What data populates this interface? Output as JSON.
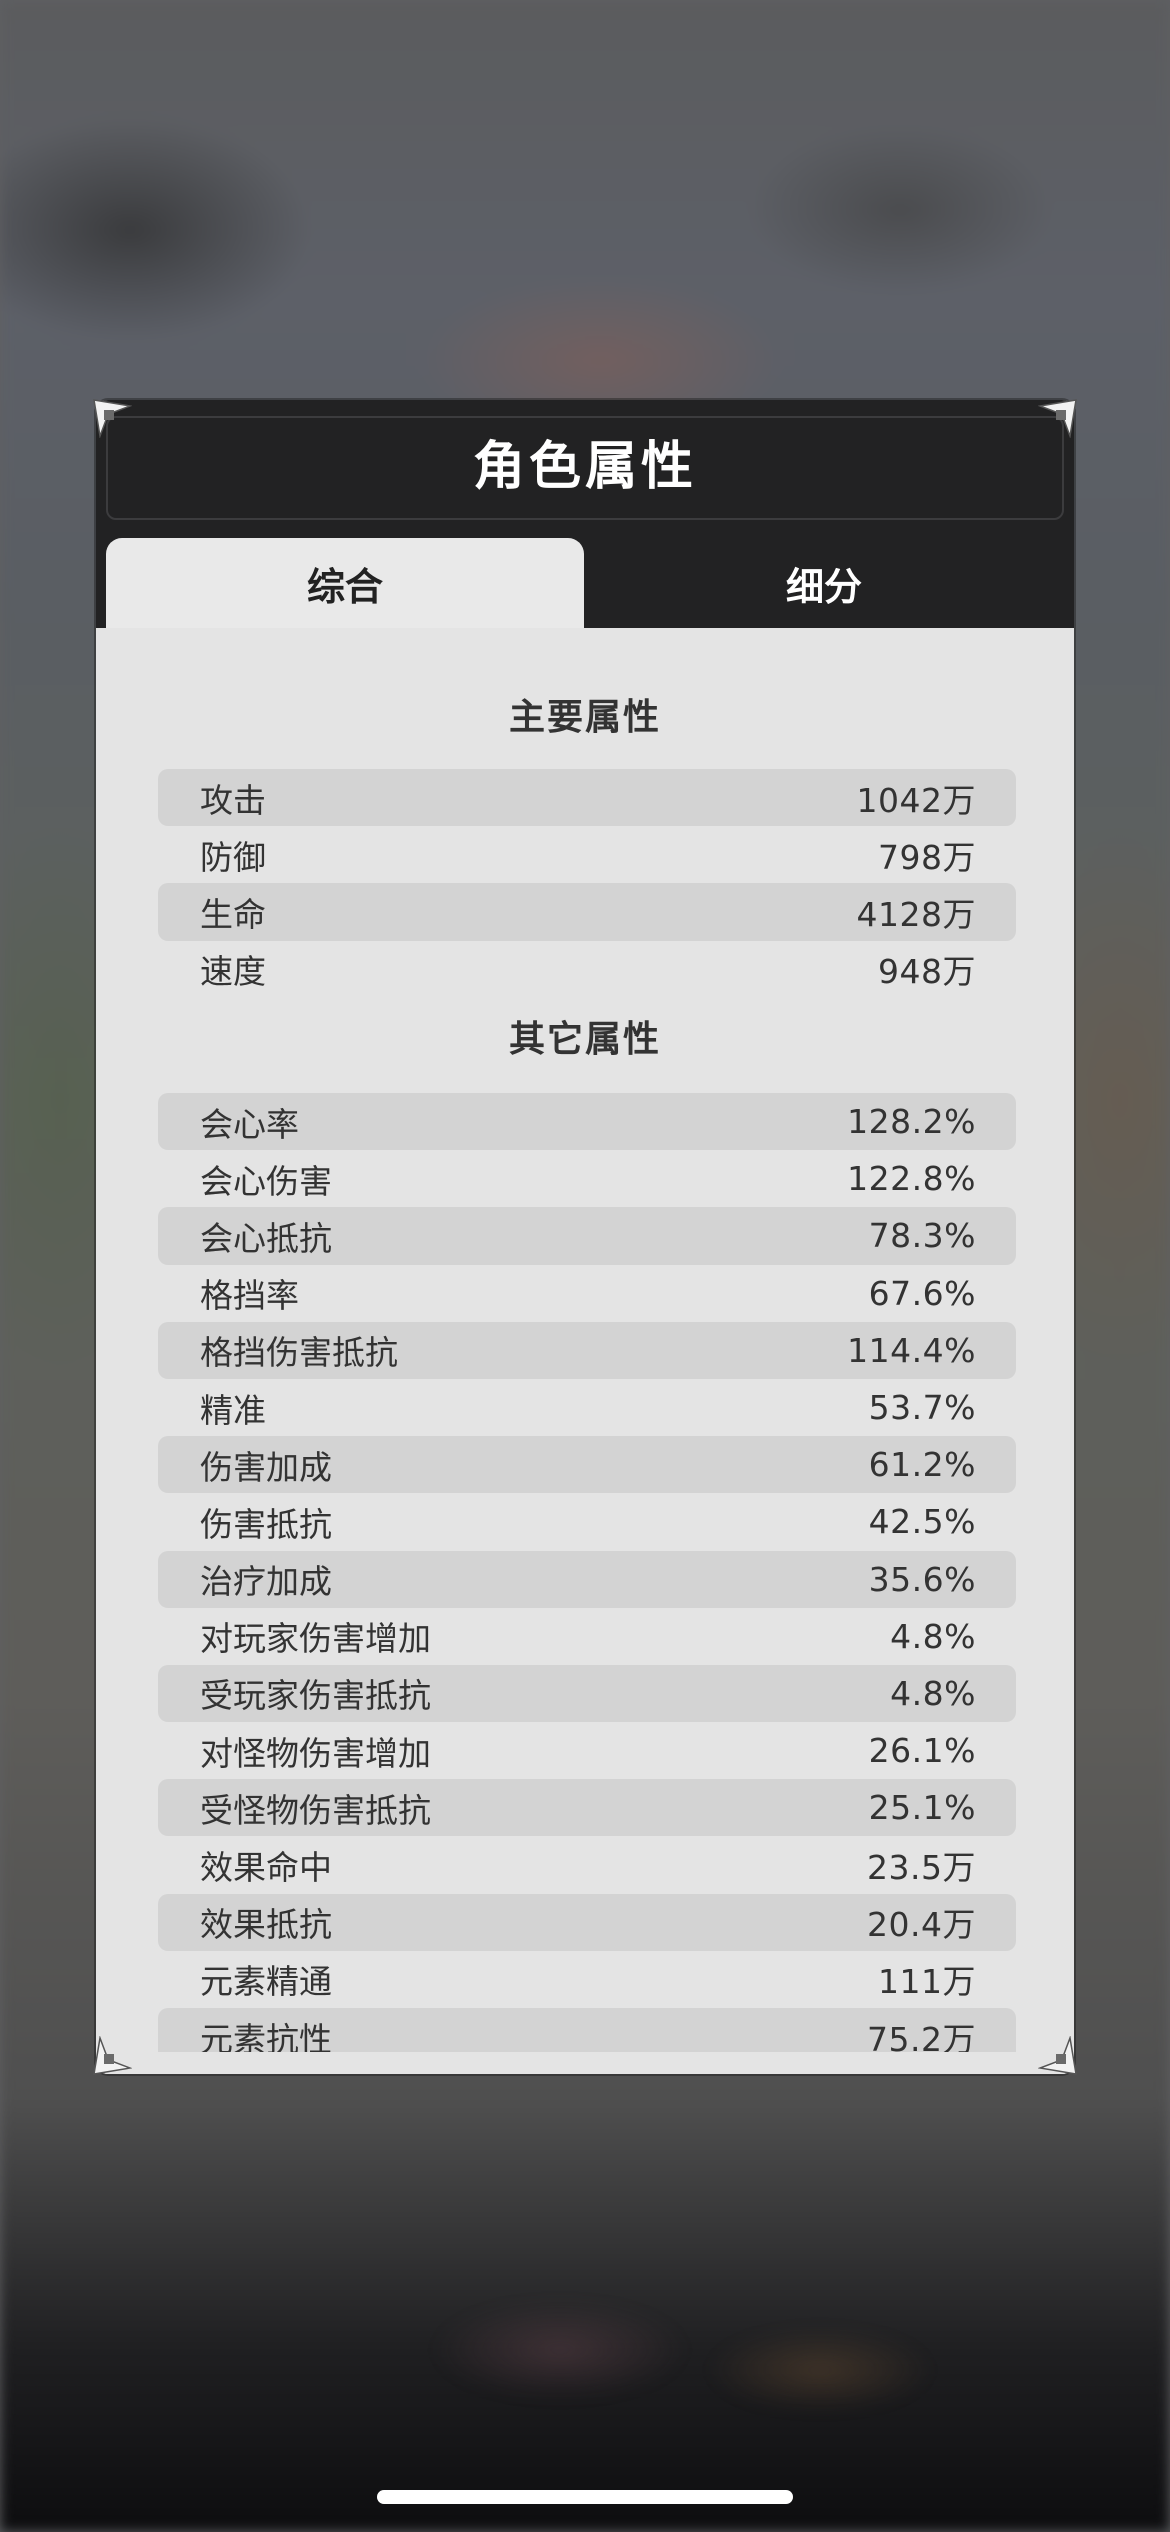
{
  "dialog": {
    "title": "角色属性",
    "tabs": [
      {
        "label": "综合",
        "active": true
      },
      {
        "label": "细分",
        "active": false
      }
    ]
  },
  "main_section": {
    "title": "主要属性",
    "rows": [
      {
        "label": "攻击",
        "value": "1042万"
      },
      {
        "label": "防御",
        "value": "798万"
      },
      {
        "label": "生命",
        "value": "4128万"
      },
      {
        "label": "速度",
        "value": "948万"
      }
    ]
  },
  "other_section": {
    "title": "其它属性",
    "rows": [
      {
        "label": "会心率",
        "value": "128.2%"
      },
      {
        "label": "会心伤害",
        "value": "122.8%"
      },
      {
        "label": "会心抵抗",
        "value": "78.3%"
      },
      {
        "label": "格挡率",
        "value": "67.6%"
      },
      {
        "label": "格挡伤害抵抗",
        "value": "114.4%"
      },
      {
        "label": "精准",
        "value": "53.7%"
      },
      {
        "label": "伤害加成",
        "value": "61.2%"
      },
      {
        "label": "伤害抵抗",
        "value": "42.5%"
      },
      {
        "label": "治疗加成",
        "value": "35.6%"
      },
      {
        "label": "对玩家伤害增加",
        "value": "4.8%"
      },
      {
        "label": "受玩家伤害抵抗",
        "value": "4.8%"
      },
      {
        "label": "对怪物伤害增加",
        "value": "26.1%"
      },
      {
        "label": "受怪物伤害抵抗",
        "value": "25.1%"
      },
      {
        "label": "效果命中",
        "value": "23.5万"
      },
      {
        "label": "效果抵抗",
        "value": "20.4万"
      },
      {
        "label": "元素精通",
        "value": "111万"
      },
      {
        "label": "元素抗性",
        "value": "75.2万"
      }
    ]
  },
  "colors": {
    "header_bg": "#222223",
    "panel_bg": "#e4e4e4",
    "row_stripe": "#d3d3d3",
    "text": "#333333"
  }
}
